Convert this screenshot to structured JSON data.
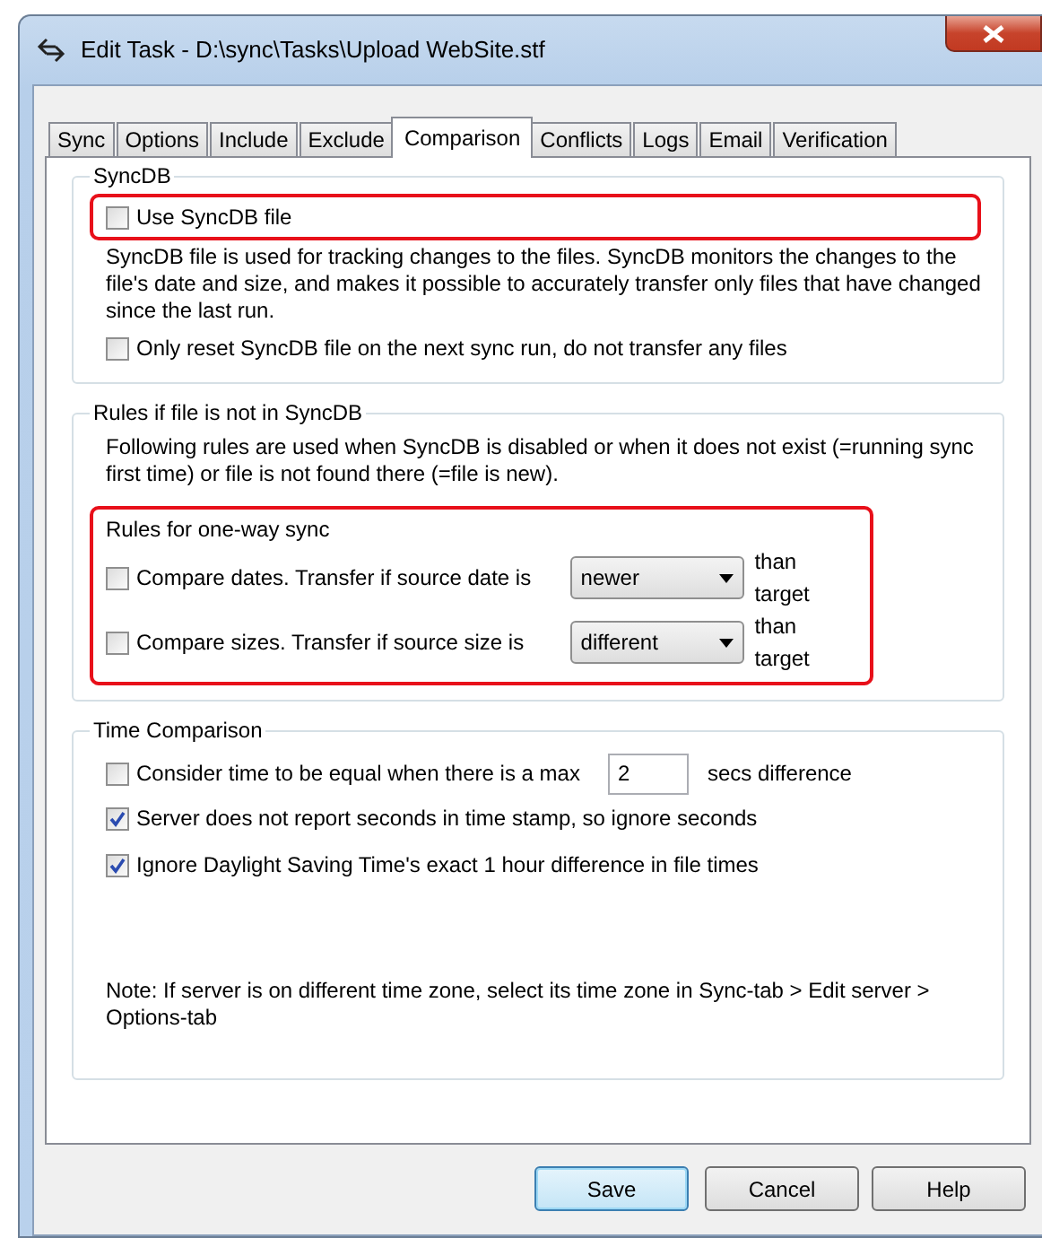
{
  "window": {
    "title": "Edit Task - D:\\sync\\Tasks\\Upload WebSite.stf"
  },
  "tabs": [
    {
      "label": "Sync",
      "selected": false
    },
    {
      "label": "Options",
      "selected": false
    },
    {
      "label": "Include",
      "selected": false
    },
    {
      "label": "Exclude",
      "selected": false
    },
    {
      "label": "Comparison",
      "selected": true
    },
    {
      "label": "Conflicts",
      "selected": false
    },
    {
      "label": "Logs",
      "selected": false
    },
    {
      "label": "Email",
      "selected": false
    },
    {
      "label": "Verification",
      "selected": false
    }
  ],
  "groups": [
    {
      "title": "SyncDB",
      "items": [
        {
          "kind": "checkbox",
          "label": "Use SyncDB file",
          "checked": false,
          "highlighted": true
        },
        {
          "kind": "text",
          "text": "SyncDB file is used for tracking changes to the files. SyncDB monitors the changes to the file's date and size, and makes it possible to accurately transfer only files that have changed since the last run."
        },
        {
          "kind": "checkbox",
          "label": "Only reset SyncDB file on the next sync run, do not transfer any files",
          "checked": false,
          "highlighted": false
        }
      ]
    },
    {
      "title": "Rules if file is not in SyncDB",
      "items": [
        {
          "kind": "text",
          "text": "Following rules are used when SyncDB is disabled or when it does not exist (=running sync first time) or file is not found there (=file is new)."
        },
        {
          "kind": "subgroup",
          "title": "Rules for one-way sync",
          "highlighted": true,
          "rows": [
            {
              "label": "Compare dates. Transfer if source date is",
              "checked": false,
              "value": "newer",
              "suffix": "than target"
            },
            {
              "label": "Compare sizes. Transfer if source size is",
              "checked": false,
              "value": "different",
              "suffix": "than target"
            }
          ]
        }
      ]
    },
    {
      "title": "Time Comparison",
      "items": [
        {
          "kind": "checkbox_input",
          "label": "Consider time to be equal when there is a max",
          "checked": false,
          "value": "2",
          "suffix": "secs difference"
        },
        {
          "kind": "checkbox",
          "label": "Server does not report seconds in time stamp, so ignore seconds",
          "checked": true,
          "highlighted": false
        },
        {
          "kind": "checkbox",
          "label": "Ignore Daylight Saving Time's exact 1 hour difference in file times",
          "checked": true,
          "highlighted": false
        },
        {
          "kind": "note",
          "text": "Note: If server is on different time zone, select its time zone in Sync-tab > Edit server > Options-tab"
        }
      ]
    }
  ],
  "buttons": [
    {
      "label": "Save",
      "default": true
    },
    {
      "label": "Cancel",
      "default": false
    },
    {
      "label": "Help",
      "default": false
    }
  ]
}
